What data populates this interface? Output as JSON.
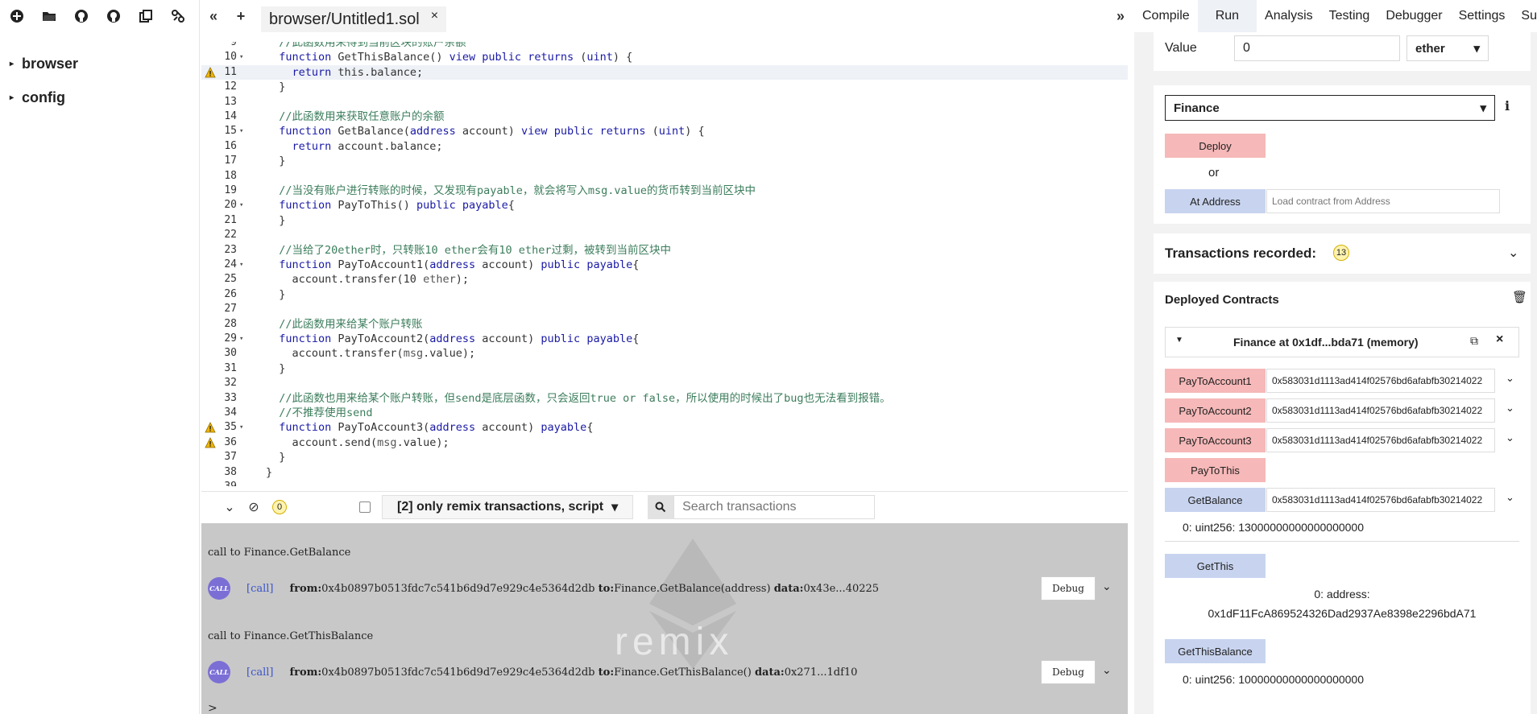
{
  "left_panel": {
    "toolbar_icons": [
      "new-file-icon",
      "open-folder-icon",
      "github-icon",
      "github-gist-icon",
      "copy-icon",
      "connect-localhost-icon"
    ],
    "tree": [
      {
        "label": "browser"
      },
      {
        "label": "config"
      }
    ]
  },
  "editor_tabs": {
    "collapse_label": "«",
    "add_label": "+",
    "expand_label": "»",
    "file_tab": "browser/Untitled1.sol",
    "close_label": "×"
  },
  "editor": {
    "lines": [
      {
        "n": "9",
        "text": "  //此函数用来得到当前区块的账户余额",
        "cls": "cm",
        "warn": false,
        "fold": false,
        "active": false
      },
      {
        "n": "10",
        "text": "  function GetThisBalance() view public returns (uint) {",
        "cls": "",
        "warn": false,
        "fold": true,
        "active": false
      },
      {
        "n": "11",
        "text": "    return this.balance;",
        "cls": "",
        "warn": true,
        "fold": false,
        "active": true
      },
      {
        "n": "12",
        "text": "  }",
        "cls": "",
        "warn": false,
        "fold": false,
        "active": false
      },
      {
        "n": "13",
        "text": "",
        "cls": "",
        "warn": false,
        "fold": false,
        "active": false
      },
      {
        "n": "14",
        "text": "  //此函数用来获取任意账户的余额",
        "cls": "cm",
        "warn": false,
        "fold": false,
        "active": false
      },
      {
        "n": "15",
        "text": "  function GetBalance(address account) view public returns (uint) {",
        "cls": "",
        "warn": false,
        "fold": true,
        "active": false
      },
      {
        "n": "16",
        "text": "    return account.balance;",
        "cls": "",
        "warn": false,
        "fold": false,
        "active": false
      },
      {
        "n": "17",
        "text": "  }",
        "cls": "",
        "warn": false,
        "fold": false,
        "active": false
      },
      {
        "n": "18",
        "text": "",
        "cls": "",
        "warn": false,
        "fold": false,
        "active": false
      },
      {
        "n": "19",
        "text": "  //当没有账户进行转账的时候，又发现有payable，就会将写入msg.value的货币转到当前区块中",
        "cls": "cm",
        "warn": false,
        "fold": false,
        "active": false
      },
      {
        "n": "20",
        "text": "  function PayToThis() public payable{",
        "cls": "",
        "warn": false,
        "fold": true,
        "active": false
      },
      {
        "n": "21",
        "text": "  }",
        "cls": "",
        "warn": false,
        "fold": false,
        "active": false
      },
      {
        "n": "22",
        "text": "",
        "cls": "",
        "warn": false,
        "fold": false,
        "active": false
      },
      {
        "n": "23",
        "text": "  //当给了20ether时，只转账10 ether会有10 ether过剩，被转到当前区块中",
        "cls": "cm",
        "warn": false,
        "fold": false,
        "active": false
      },
      {
        "n": "24",
        "text": "  function PayToAccount1(address account) public payable{",
        "cls": "",
        "warn": false,
        "fold": true,
        "active": false
      },
      {
        "n": "25",
        "text": "    account.transfer(10 ether);",
        "cls": "",
        "warn": false,
        "fold": false,
        "active": false
      },
      {
        "n": "26",
        "text": "  }",
        "cls": "",
        "warn": false,
        "fold": false,
        "active": false
      },
      {
        "n": "27",
        "text": "",
        "cls": "",
        "warn": false,
        "fold": false,
        "active": false
      },
      {
        "n": "28",
        "text": "  //此函数用来给某个账户转账",
        "cls": "cm",
        "warn": false,
        "fold": false,
        "active": false
      },
      {
        "n": "29",
        "text": "  function PayToAccount2(address account) public payable{",
        "cls": "",
        "warn": false,
        "fold": true,
        "active": false
      },
      {
        "n": "30",
        "text": "    account.transfer(msg.value);",
        "cls": "",
        "warn": false,
        "fold": false,
        "active": false
      },
      {
        "n": "31",
        "text": "  }",
        "cls": "",
        "warn": false,
        "fold": false,
        "active": false
      },
      {
        "n": "32",
        "text": "",
        "cls": "",
        "warn": false,
        "fold": false,
        "active": false
      },
      {
        "n": "33",
        "text": "  //此函数也用来给某个账户转账，但send是底层函数，只会返回true or false，所以使用的时候出了bug也无法看到报错。",
        "cls": "cm",
        "warn": false,
        "fold": false,
        "active": false
      },
      {
        "n": "34",
        "text": "  //不推荐使用send",
        "cls": "cm",
        "warn": false,
        "fold": false,
        "active": false
      },
      {
        "n": "35",
        "text": "  function PayToAccount3(address account) payable{",
        "cls": "",
        "warn": true,
        "fold": true,
        "active": false
      },
      {
        "n": "36",
        "text": "    account.send(msg.value);",
        "cls": "",
        "warn": true,
        "fold": false,
        "active": false
      },
      {
        "n": "37",
        "text": "  }",
        "cls": "",
        "warn": false,
        "fold": false,
        "active": false
      },
      {
        "n": "38",
        "text": "}",
        "cls": "",
        "warn": false,
        "fold": false,
        "active": false
      },
      {
        "n": "39",
        "text": "",
        "cls": "",
        "warn": false,
        "fold": false,
        "active": false
      }
    ]
  },
  "terminal_bar": {
    "collapse_icon": "double-chevron-down-icon",
    "clear_icon": "clear-console-icon",
    "pending_count": "0",
    "filter_label": "[2] only remix transactions, script",
    "search_placeholder": "Search transactions"
  },
  "terminal": {
    "watermark_text": "remix",
    "entries": [
      {
        "call_text": "call to Finance.GetBalance",
        "badge": "CALL",
        "tag": "[call]",
        "from_label": "from:",
        "from": "0x4b0897b0513fdc7c541b6d9d7e929c4e5364d2db",
        "to_label": "to:",
        "to": "Finance.GetBalance(address)",
        "data_label": "data:",
        "data": "0x43e...40225",
        "debug": "Debug"
      },
      {
        "call_text": "call to Finance.GetThisBalance",
        "badge": "CALL",
        "tag": "[call]",
        "from_label": "from:",
        "from": "0x4b0897b0513fdc7c541b6d9d7e929c4e5364d2db",
        "to_label": "to:",
        "to": "Finance.GetThisBalance()",
        "data_label": "data:",
        "data": "0x271...1df10",
        "debug": "Debug"
      }
    ],
    "prompt": ">"
  },
  "right_panel": {
    "tabs": [
      {
        "label": "Compile",
        "active": false
      },
      {
        "label": "Run",
        "active": true
      },
      {
        "label": "Analysis",
        "active": false
      },
      {
        "label": "Testing",
        "active": false
      },
      {
        "label": "Debugger",
        "active": false
      },
      {
        "label": "Settings",
        "active": false
      },
      {
        "label": "Sup",
        "active": false
      }
    ],
    "value_label": "Value",
    "value_input": "0",
    "value_unit": "ether",
    "contract_select": "Finance",
    "info_icon": "i",
    "deploy_label": "Deploy",
    "or_label": "or",
    "at_address_label": "At Address",
    "at_address_placeholder": "Load contract from Address",
    "tx_recorded_label": "Transactions recorded:",
    "tx_recorded_count": "13",
    "deployed_label": "Deployed Contracts",
    "instance_title": "Finance at 0x1df...bda71 (memory)",
    "functions": [
      {
        "label": "PayToAccount1",
        "kind": "payable",
        "arg": "0x583031d1113ad414f02576bd6afabfb30214022"
      },
      {
        "label": "PayToAccount2",
        "kind": "payable",
        "arg": "0x583031d1113ad414f02576bd6afabfb30214022"
      },
      {
        "label": "PayToAccount3",
        "kind": "payable",
        "arg": "0x583031d1113ad414f02576bd6afabfb30214022"
      },
      {
        "label": "PayToThis",
        "kind": "payable",
        "arg": ""
      },
      {
        "label": "GetBalance",
        "kind": "call",
        "arg": "0x583031d1113ad414f02576bd6afabfb30214022"
      }
    ],
    "getbalance_result": "0: uint256: 13000000000000000000",
    "getthis_label": "GetThis",
    "getthis_result_1": "0: address:",
    "getthis_result_2": "0x1dF11FcA869524326Dad2937Ae8398e2296bdA71",
    "getthisbalance_label": "GetThisBalance",
    "getthisbalance_result": "0: uint256: 10000000000000000000"
  }
}
